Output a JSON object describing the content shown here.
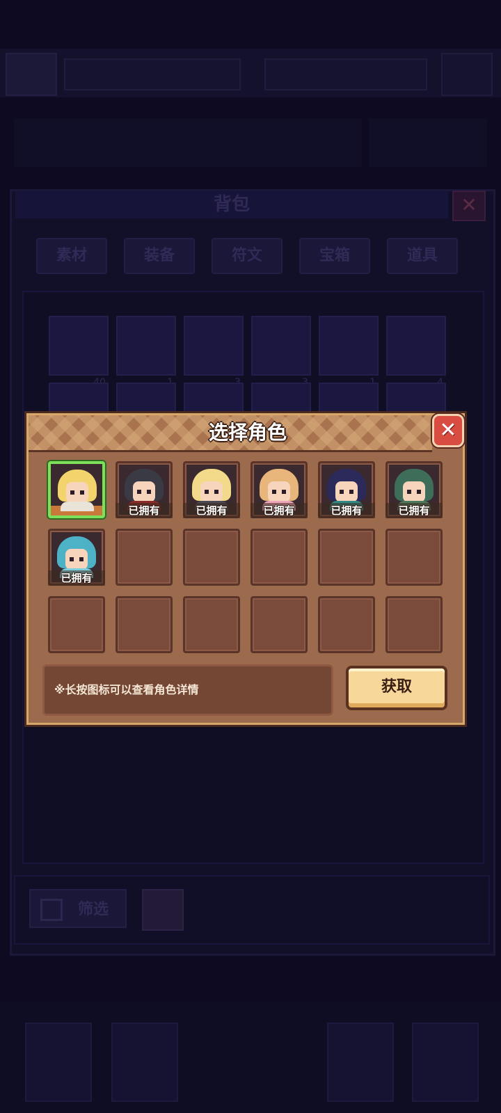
{
  "background": {
    "panel_title": "背包",
    "tabs": [
      "素材",
      "装备",
      "符文",
      "宝箱",
      "道具"
    ],
    "item_counts": [
      "40",
      "1",
      "3",
      "3",
      "1",
      "4"
    ],
    "filter_label": "筛选"
  },
  "modal": {
    "title": "选择角色",
    "hint": "※长按图标可以查看角色详情",
    "get_button": "获取",
    "owned_label": "已拥有",
    "characters": [
      {
        "hair": "#f2d36c",
        "outfit": "#e9e3d8",
        "selected": true,
        "owned": false
      },
      {
        "hair": "#3a3a44",
        "outfit": "#8b2a2a",
        "selected": false,
        "owned": true
      },
      {
        "hair": "#f3d98a",
        "outfit": "#4a4a55",
        "selected": false,
        "owned": true
      },
      {
        "hair": "#e8b57a",
        "outfit": "#f0a6b8",
        "selected": false,
        "owned": true
      },
      {
        "hair": "#2c2a5a",
        "outfit": "#2f8a86",
        "selected": false,
        "owned": true
      },
      {
        "hair": "#3e6e5a",
        "outfit": "#4c7a5c",
        "selected": false,
        "owned": true
      },
      {
        "hair": "#4eb2c6",
        "outfit": "#7fd0de",
        "selected": false,
        "owned": true
      }
    ]
  }
}
